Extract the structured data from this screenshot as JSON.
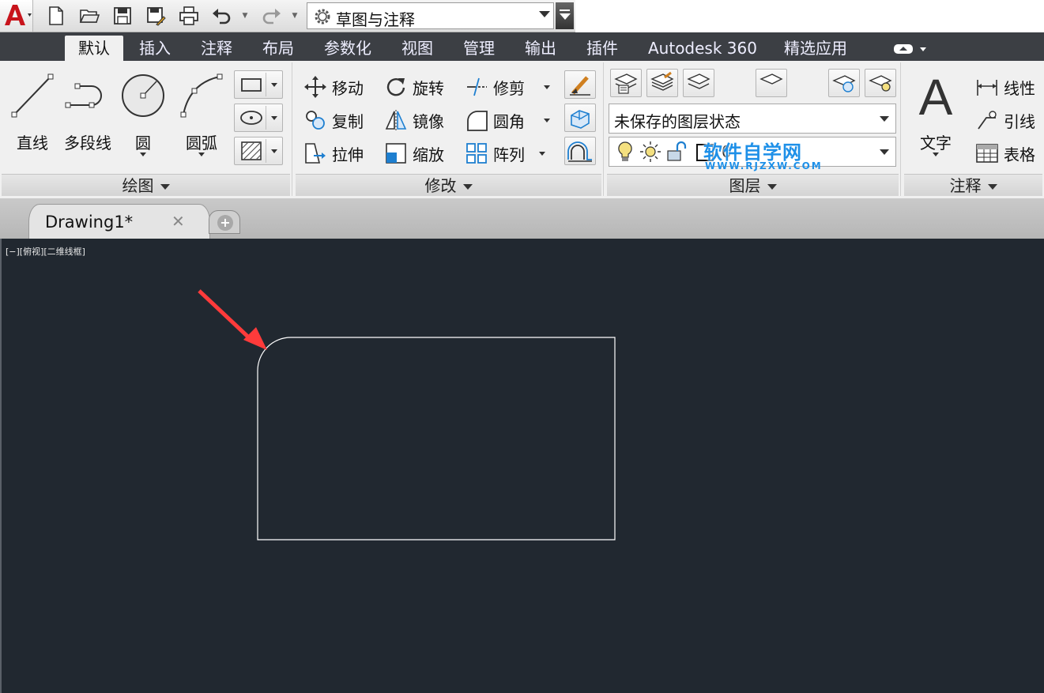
{
  "quick_access": {
    "workspace": "草图与注释"
  },
  "ribbon_tabs": [
    "默认",
    "插入",
    "注释",
    "布局",
    "参数化",
    "视图",
    "管理",
    "输出",
    "插件",
    "Autodesk 360",
    "精选应用"
  ],
  "panels": {
    "draw": {
      "title": "绘图",
      "tools": [
        "直线",
        "多段线",
        "圆",
        "圆弧"
      ]
    },
    "modify": {
      "title": "修改",
      "tools": [
        "移动",
        "旋转",
        "修剪",
        "复制",
        "镜像",
        "圆角",
        "拉伸",
        "缩放",
        "阵列"
      ]
    },
    "layers": {
      "title": "图层",
      "layer_state": "未保存的图层状态",
      "current_layer": "0"
    },
    "annotation": {
      "title": "注释",
      "text_label": "文字",
      "tools": [
        "线性",
        "引线",
        "表格"
      ]
    }
  },
  "watermark": {
    "cn": "软件自学网",
    "en": "WWW.RJZXW.COM"
  },
  "file_tab": {
    "name": "Drawing1*"
  },
  "viewport": {
    "controls": "[−][俯视][二维线框]"
  },
  "colors": {
    "canvas_bg": "#212830",
    "geometry_line": "#ffffff",
    "annotation_arrow": "#ff3b3b",
    "tab_bar": "#3c3f44"
  }
}
